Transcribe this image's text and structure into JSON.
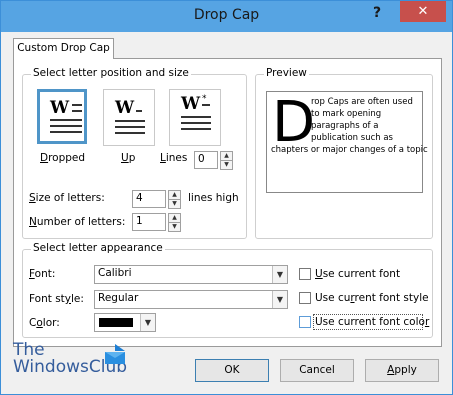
{
  "window": {
    "title": "Drop Cap",
    "help_label": "?",
    "close_label": "✕"
  },
  "tab": {
    "label": "Custom Drop Cap"
  },
  "position": {
    "group_title": "Select letter position and size",
    "options": [
      {
        "label": "Dropped",
        "mnemonic": "D",
        "rest": "ropped",
        "selected": true
      },
      {
        "label": "Up",
        "mnemonic": "U",
        "rest": "p",
        "selected": false
      },
      {
        "label": "Lines",
        "mnemonic": "L",
        "rest": "ines",
        "selected": false
      }
    ],
    "lines_value": "0",
    "size_label_mn": "S",
    "size_label_rest": "ize of letters:",
    "size_value": "4",
    "lines_high_label": "lines high",
    "number_label_mn": "N",
    "number_label_rest": "umber of letters:",
    "number_value": "1"
  },
  "preview": {
    "title": "Preview",
    "dropcap": "D",
    "lines": [
      "rop Caps are often used",
      "to mark opening",
      "paragraphs of a",
      "publication such as",
      "chapters or major changes of a topic"
    ]
  },
  "appearance": {
    "group_title": "Select letter appearance",
    "font_label_mn": "F",
    "font_label_rest": "ont:",
    "font_value": "Calibri",
    "style_label_pre": "Font st",
    "style_label_mn": "y",
    "style_label_rest": "le:",
    "style_value": "Regular",
    "color_label_pre": "C",
    "color_label_mn": "o",
    "color_label_rest": "lor:",
    "color_value": "#000000",
    "use_font_pre": "",
    "use_font_mn": "U",
    "use_font_rest": "se current font",
    "use_style_pre": "Use cu",
    "use_style_mn": "r",
    "use_style_rest": "rent font style",
    "use_color_pre": "Use current font colo",
    "use_color_mn": "r",
    "use_color_rest": ""
  },
  "buttons": {
    "ok": "OK",
    "cancel": "Cancel",
    "apply_mn": "A",
    "apply_rest": "pply"
  },
  "watermark": {
    "line1": "The",
    "line2": "WindowsClub"
  },
  "colors": {
    "titlebar": "#56a4e3",
    "close": "#c7504c",
    "selected_border": "#4f95c8"
  }
}
